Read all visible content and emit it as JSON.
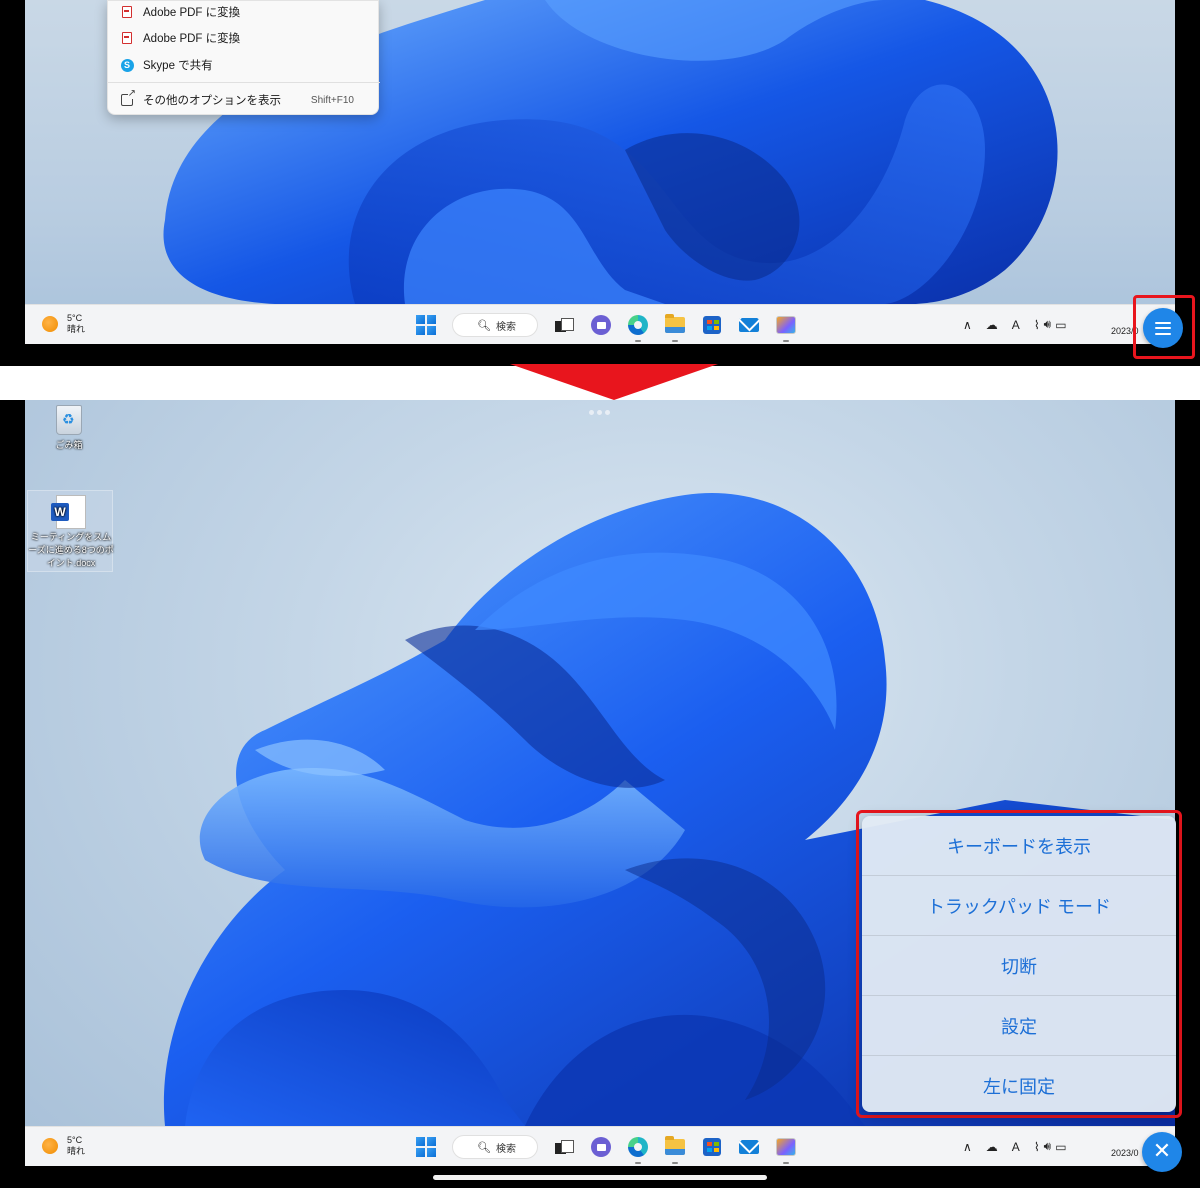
{
  "top": {
    "context_menu": {
      "items": [
        {
          "icon": "pdf-icon",
          "label": "Adobe PDF に変換",
          "shortcut": ""
        },
        {
          "icon": "pdf-icon",
          "label": "Adobe PDF に変換",
          "shortcut": ""
        },
        {
          "icon": "skype-icon",
          "label": "Skype で共有",
          "shortcut": ""
        },
        {
          "icon": "external-icon",
          "label": "その他のオプションを表示",
          "shortcut": "Shift+F10"
        }
      ]
    },
    "taskbar": {
      "weather_temp": "5°C",
      "weather_desc": "晴れ",
      "search_label": "検索",
      "clock": "2023/0"
    },
    "fab_icon": "hamburger-menu-icon"
  },
  "bottom": {
    "desktop_icons": [
      {
        "name": "recycle-bin",
        "label": "ごみ箱"
      },
      {
        "name": "word-document",
        "label": "ミーティングをスムーズに進める8つのポイント.docx"
      }
    ],
    "popup_menu": {
      "items": [
        "キーボードを表示",
        "トラックパッド モード",
        "切断",
        "設定",
        "左に固定"
      ]
    },
    "taskbar": {
      "weather_temp": "5°C",
      "weather_desc": "晴れ",
      "search_label": "検索",
      "clock": "2023/0"
    },
    "fab_icon": "close-icon"
  },
  "colors": {
    "highlight_red": "#e8151d",
    "accent_blue": "#1f86e8",
    "menu_text_blue": "#1c6fd6"
  }
}
